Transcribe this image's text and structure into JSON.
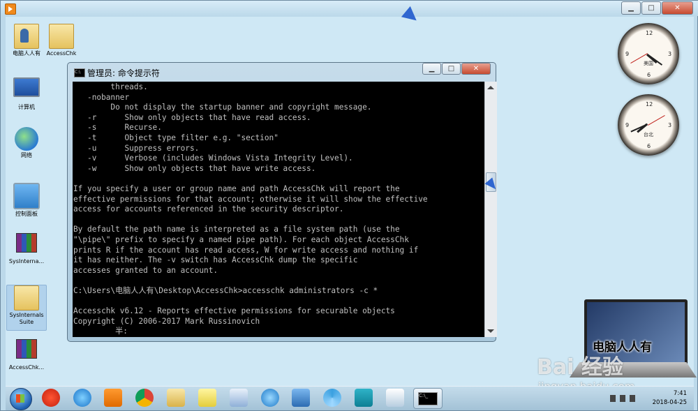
{
  "desktop_icons": [
    {
      "label": "电脑人人有",
      "glyph": "user-folder-icon"
    },
    {
      "label": "AccessChk",
      "glyph": "folder-icon"
    },
    {
      "label": "计算机",
      "glyph": "computer-icon"
    },
    {
      "label": "网络",
      "glyph": "network-icon"
    },
    {
      "label": "控制面板",
      "glyph": "control-panel-icon"
    },
    {
      "label": "SysInterna...",
      "glyph": "winrar-icon"
    },
    {
      "label": "SysInternals Suite",
      "glyph": "folder-icon"
    },
    {
      "label": "AccessChk...",
      "glyph": "winrar-icon"
    }
  ],
  "clocks": [
    {
      "city": "美国",
      "hour": 4,
      "minute": 21,
      "second": 40
    },
    {
      "city": "台北",
      "hour": 7,
      "minute": 41,
      "second": 10
    }
  ],
  "cmd_window": {
    "title": "管理员: 命令提示符",
    "lines": [
      "        threads.",
      "   -nobanner",
      "        Do not display the startup banner and copyright message.",
      "   -r      Show only objects that have read access.",
      "   -s      Recurse.",
      "   -t      Object type filter e.g. \"section\"",
      "   -u      Suppress errors.",
      "   -v      Verbose (includes Windows Vista Integrity Level).",
      "   -w      Show only objects that have write access.",
      "",
      "If you specify a user or group name and path AccessChk will report the",
      "effective permissions for that account; otherwise it will show the effective",
      "access for accounts referenced in the security descriptor.",
      "",
      "By default the path name is interpreted as a file system path (use the",
      "\"\\pipe\\\" prefix to specify a named pipe path). For each object AccessChk",
      "prints R if the account has read access, W for write access and nothing if",
      "it has neither. The -v switch has AccessChk dump the specific",
      "accesses granted to an account.",
      "",
      "C:\\Users\\电脑人人有\\Desktop\\AccessChk>accesschk administrators -c *",
      "",
      "Accesschk v6.12 - Reports effective permissions for securable objects",
      "Copyright (C) 2006-2017 Mark Russinovich",
      "         半:"
    ],
    "scroll_position": 0.37
  },
  "watermarks": {
    "laptop_caption": "电脑人人有",
    "baidu": "Bai 经验",
    "jingyan": "jingyan.baidu.com"
  },
  "taskbar": {
    "pinned": [
      "start-button",
      "browser-360-icon",
      "ie-icon",
      "media-player-icon",
      "chrome-icon",
      "explorer-icon",
      "notes-icon",
      "files-icon",
      "qq-icon",
      "screen-icon",
      "pinwheel-icon",
      "headset-icon",
      "paint-icon",
      "cmd-icon"
    ],
    "time": "7:41",
    "date": "2018-04-25"
  }
}
